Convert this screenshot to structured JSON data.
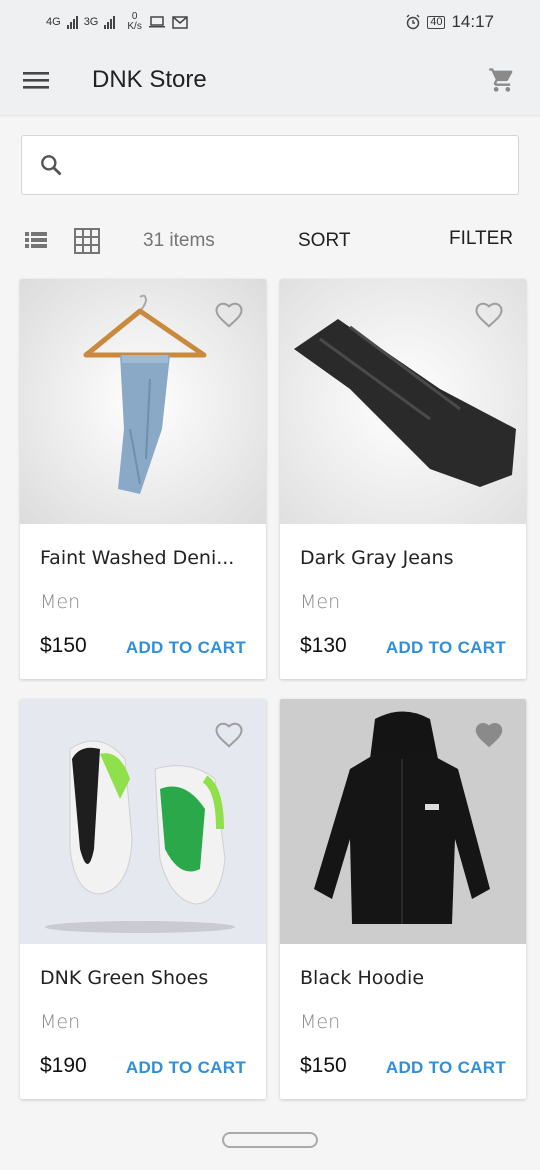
{
  "status": {
    "net1": "4G",
    "net2": "3G",
    "speed_value": "0",
    "speed_unit": "K/s",
    "battery": "40",
    "time": "14:17"
  },
  "appbar": {
    "title": "DNK Store",
    "menu_icon": "hamburger-menu-icon",
    "cart_icon": "shopping-cart-icon"
  },
  "search": {
    "value": "",
    "placeholder": "",
    "icon": "search-icon"
  },
  "toolbar": {
    "items_count": "31 items",
    "sort_label": "SORT",
    "filter_label": "FILTER",
    "list_icon": "list-view-icon",
    "grid_icon": "grid-view-icon"
  },
  "products": [
    {
      "name": "Faint Washed Deni...",
      "category": "Men",
      "price": "$150",
      "action": "ADD TO CART",
      "favorite": false
    },
    {
      "name": "Dark Gray Jeans",
      "category": "Men",
      "price": "$130",
      "action": "ADD TO CART",
      "favorite": false
    },
    {
      "name": "DNK Green Shoes",
      "category": "Men",
      "price": "$190",
      "action": "ADD TO CART",
      "favorite": false
    },
    {
      "name": "Black Hoodie",
      "category": "Men",
      "price": "$150",
      "action": "ADD TO CART",
      "favorite": true
    }
  ],
  "colors": {
    "accent": "#2f8fdb",
    "appbar_bg": "#eef0f2",
    "page_bg": "#f5f5f5"
  }
}
